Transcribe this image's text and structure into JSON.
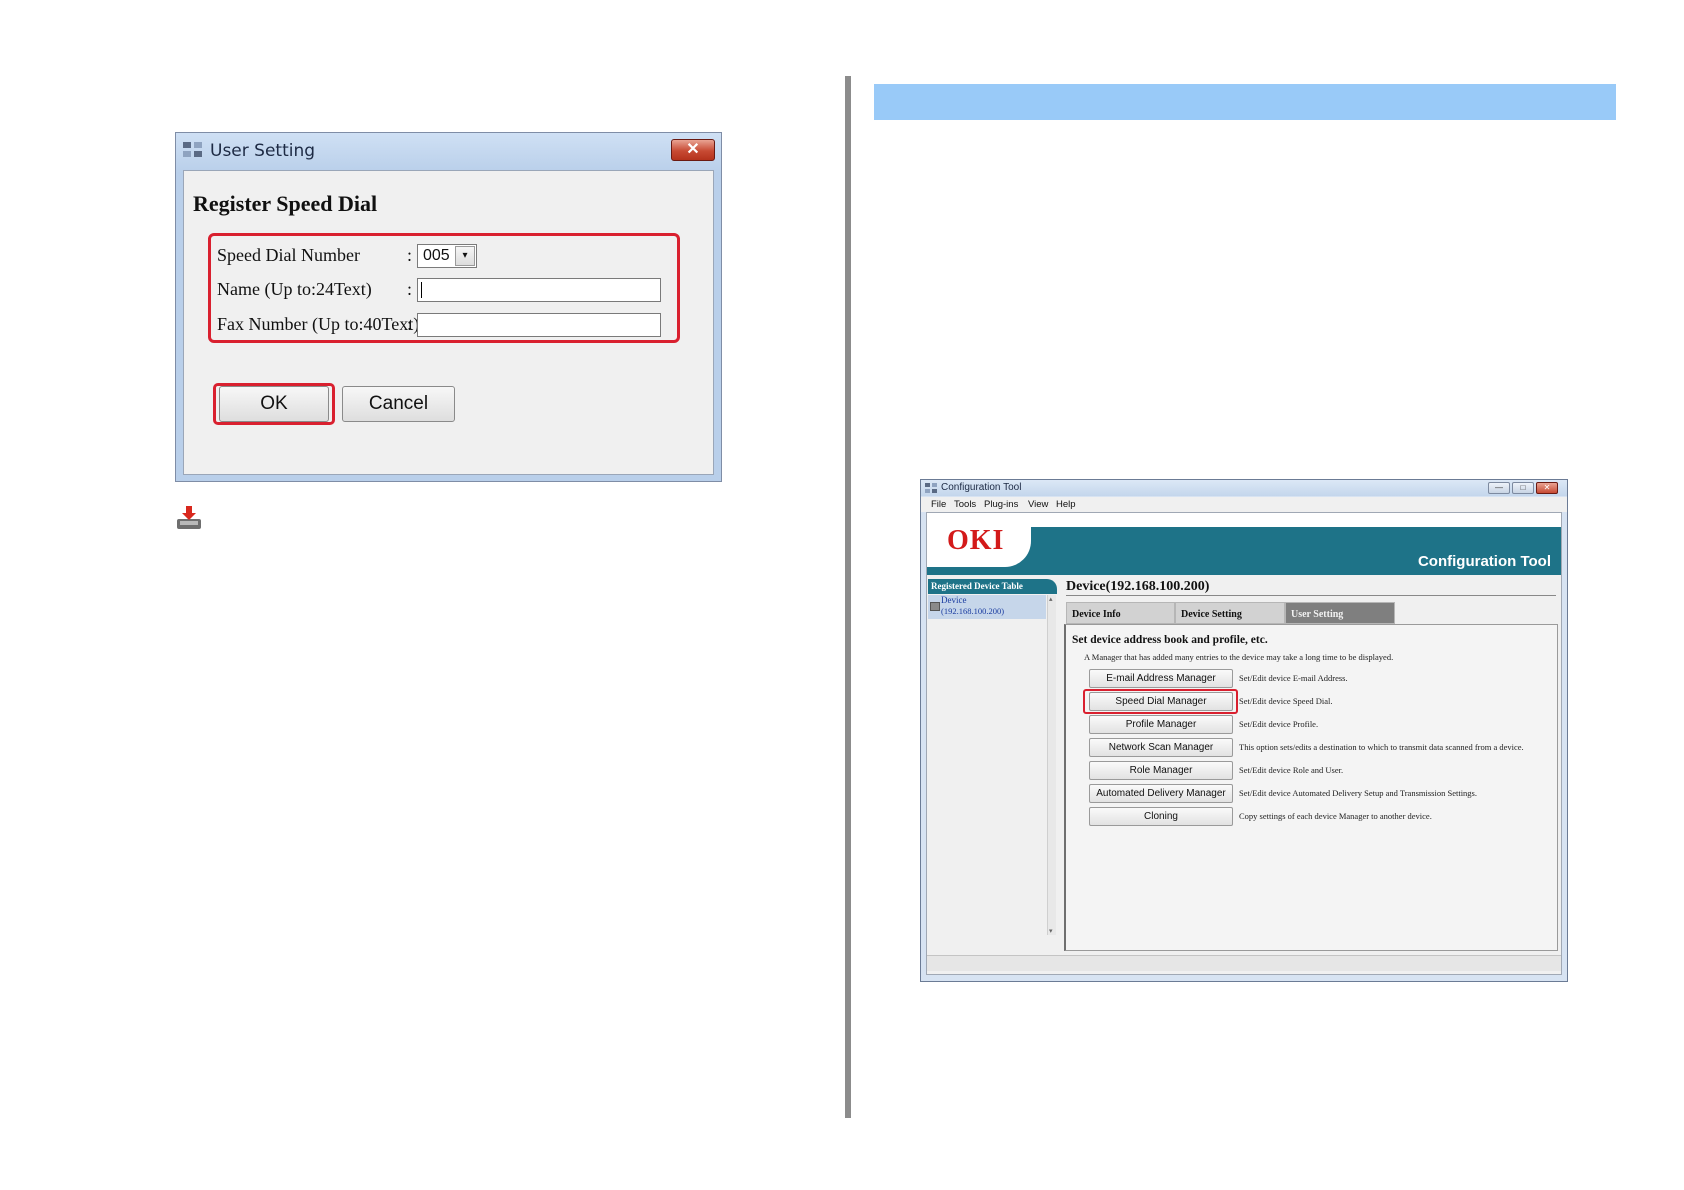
{
  "dialog": {
    "title": "User Setting",
    "close_glyph": "✕",
    "heading": "Register Speed Dial",
    "fields": [
      {
        "label": "Speed Dial Number",
        "colon": ":",
        "value": "005",
        "dropdown_glyph": "▾"
      },
      {
        "label": "Name (Up to:24Text)",
        "colon": ":",
        "value": ""
      },
      {
        "label": "Fax Number (Up to:40Text)",
        "colon": ":",
        "value": ""
      }
    ],
    "ok_label": "OK",
    "cancel_label": "Cancel"
  },
  "note_icon": "download-tray-icon",
  "config_tool": {
    "window_title": "Configuration Tool",
    "window_buttons": [
      "—",
      "□",
      "✕"
    ],
    "menu": [
      "File",
      "Tools",
      "Plug-ins",
      "View",
      "Help"
    ],
    "logo": "OKI",
    "product_name": "Configuration Tool",
    "sidebar": {
      "header": "Registered Device Table",
      "device_name": "Device",
      "device_ip": "(192.168.100.200)",
      "scroll_up": "▴",
      "scroll_down": "▾"
    },
    "device_title": "Device(192.168.100.200)",
    "tabs": [
      "Device Info",
      "Device Setting",
      "User Setting"
    ],
    "active_tab": "User Setting",
    "content_heading": "Set device address book and profile, etc.",
    "content_note": "A Manager that has added many entries to the device may take a long time to be displayed.",
    "managers": [
      {
        "button": "E-mail Address Manager",
        "description": "Set/Edit device E-mail Address."
      },
      {
        "button": "Speed Dial Manager",
        "description": "Set/Edit device Speed Dial."
      },
      {
        "button": "Profile Manager",
        "description": "Set/Edit device Profile."
      },
      {
        "button": "Network Scan Manager",
        "description": "This option sets/edits a destination to which to transmit data scanned from a device."
      },
      {
        "button": "Role Manager",
        "description": "Set/Edit device Role and User."
      },
      {
        "button": "Automated Delivery Manager",
        "description": "Set/Edit device Automated Delivery Setup and Transmission Settings."
      },
      {
        "button": "Cloning",
        "description": "Copy settings of each device Manager to another device."
      }
    ]
  },
  "colors": {
    "highlight": "#d9202f",
    "section_bar": "#99caf8",
    "banner_teal": "#1e7388",
    "oki_red": "#d31a1a"
  }
}
